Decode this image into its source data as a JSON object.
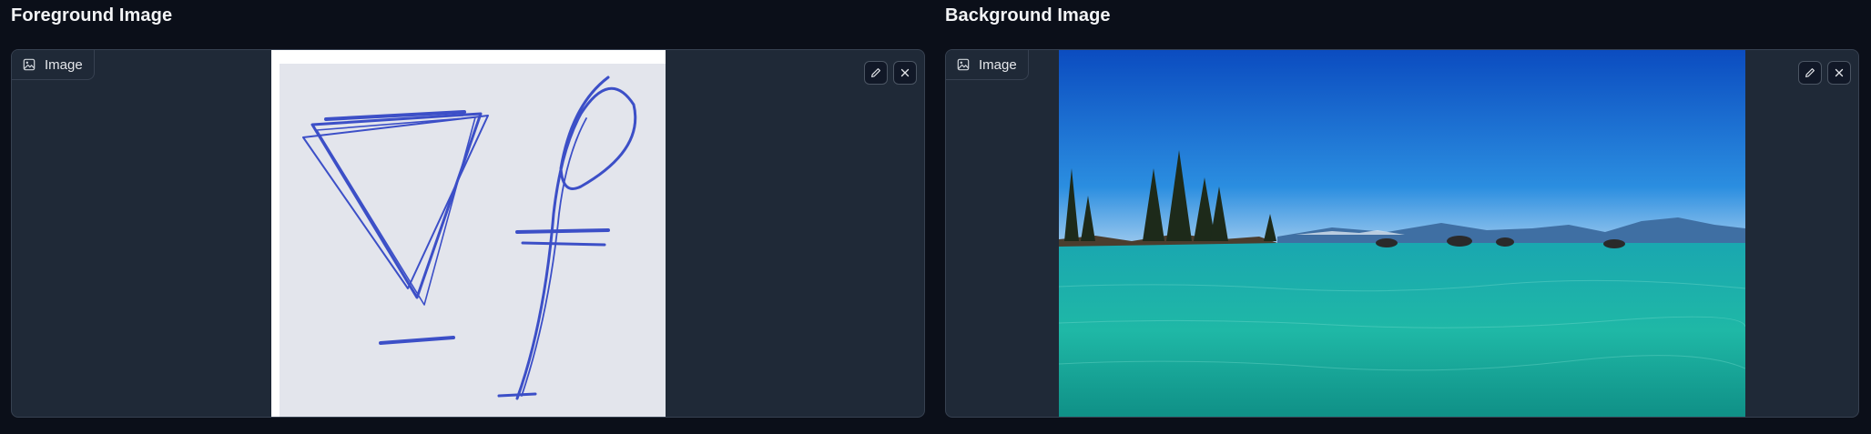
{
  "foreground": {
    "title": "Foreground Image",
    "label": "Image",
    "image_icon": "image-icon",
    "edit_icon": "pencil-icon",
    "clear_icon": "close-icon",
    "image_description": "blue pen sketch"
  },
  "background": {
    "title": "Background Image",
    "label": "Image",
    "image_icon": "image-icon",
    "edit_icon": "pencil-icon",
    "clear_icon": "close-icon",
    "image_description": "lake with trees and mountains"
  },
  "colors": {
    "page_bg": "#0b0f19",
    "panel_bg": "#1f2937",
    "border": "#374151",
    "ink": "#2a3fc4",
    "sky_top": "#0a4fc0",
    "water": "#1fb5a8"
  }
}
